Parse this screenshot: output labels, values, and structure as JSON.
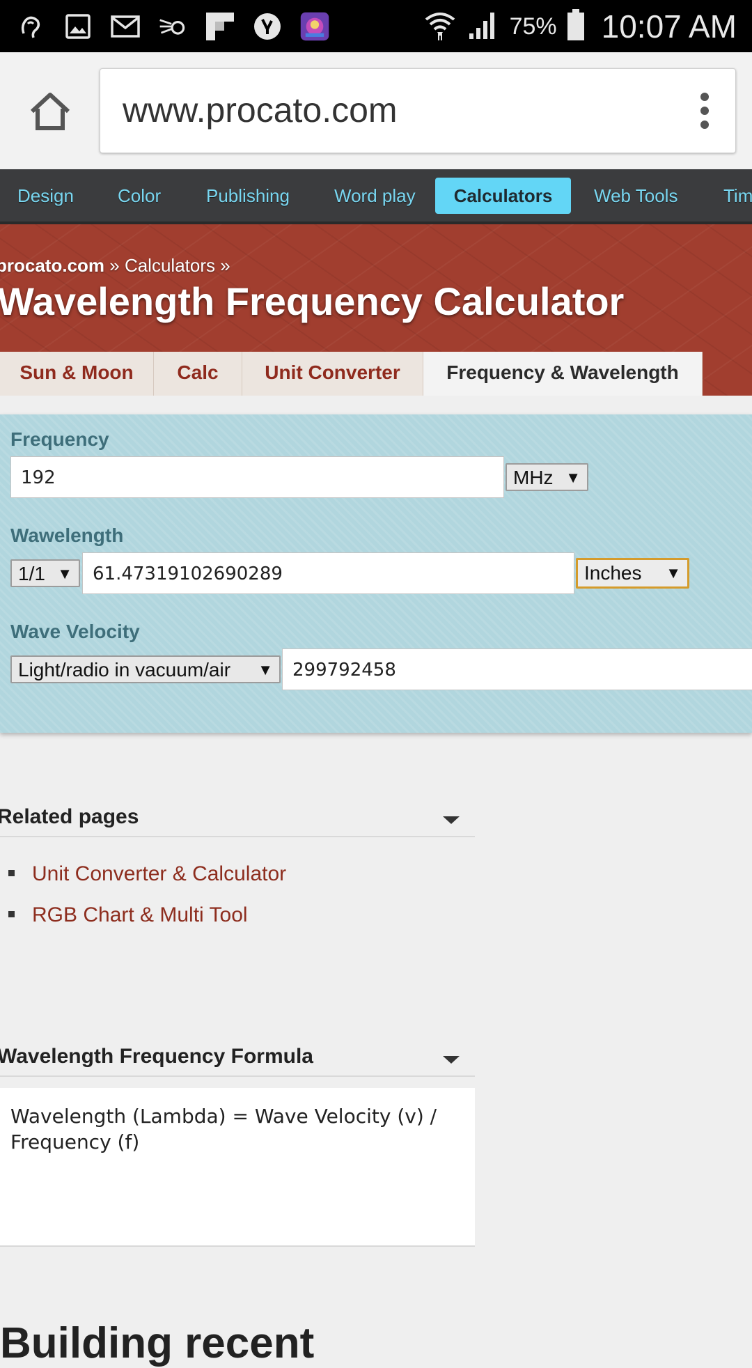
{
  "status_bar": {
    "notification_icons": [
      "hearing-icon",
      "image-icon",
      "gmail-icon",
      "gesture-icon",
      "flipboard-icon",
      "yelp-icon",
      "game-app-icon"
    ],
    "battery": "75%",
    "time": "10:07 AM"
  },
  "browser": {
    "url": "www.procato.com"
  },
  "site_nav": {
    "items": [
      {
        "label": "Design"
      },
      {
        "label": "Color"
      },
      {
        "label": "Publishing"
      },
      {
        "label": "Word play"
      },
      {
        "label": "Calculators",
        "active": true
      },
      {
        "label": "Web Tools"
      },
      {
        "label": "Tim"
      }
    ],
    "link_color": "#79d7f1",
    "active_bg": "#63d6f6"
  },
  "header": {
    "breadcrumb_site": "procato.com",
    "breadcrumb_rest": " » Calculators »",
    "title": "Wavelength Frequency Calculator",
    "banner_color": "#a13e2f",
    "tabs": [
      {
        "label": "Sun & Moon"
      },
      {
        "label": "Calc"
      },
      {
        "label": "Unit Converter"
      },
      {
        "label": "Frequency & Wavelength",
        "active": true
      }
    ]
  },
  "calculator": {
    "frequency": {
      "label": "Frequency",
      "value": "192",
      "unit": "MHz"
    },
    "wavelength": {
      "label": "Wawelength",
      "fraction": "1/1",
      "value": "61.47319102690289",
      "unit": "Inches"
    },
    "velocity": {
      "label": "Wave Velocity",
      "medium": "Light/radio in vacuum/air",
      "value": "299792458"
    },
    "panel_color": "#b1d6de"
  },
  "related": {
    "title": "Related pages",
    "links": [
      "Unit Converter & Calculator",
      "RGB Chart & Multi Tool"
    ]
  },
  "formula": {
    "title": "Wavelength Frequency Formula",
    "text": "Wavelength (Lambda) = Wave Velocity (v) / Frequency (f)"
  },
  "bottom_heading": "Building recent"
}
